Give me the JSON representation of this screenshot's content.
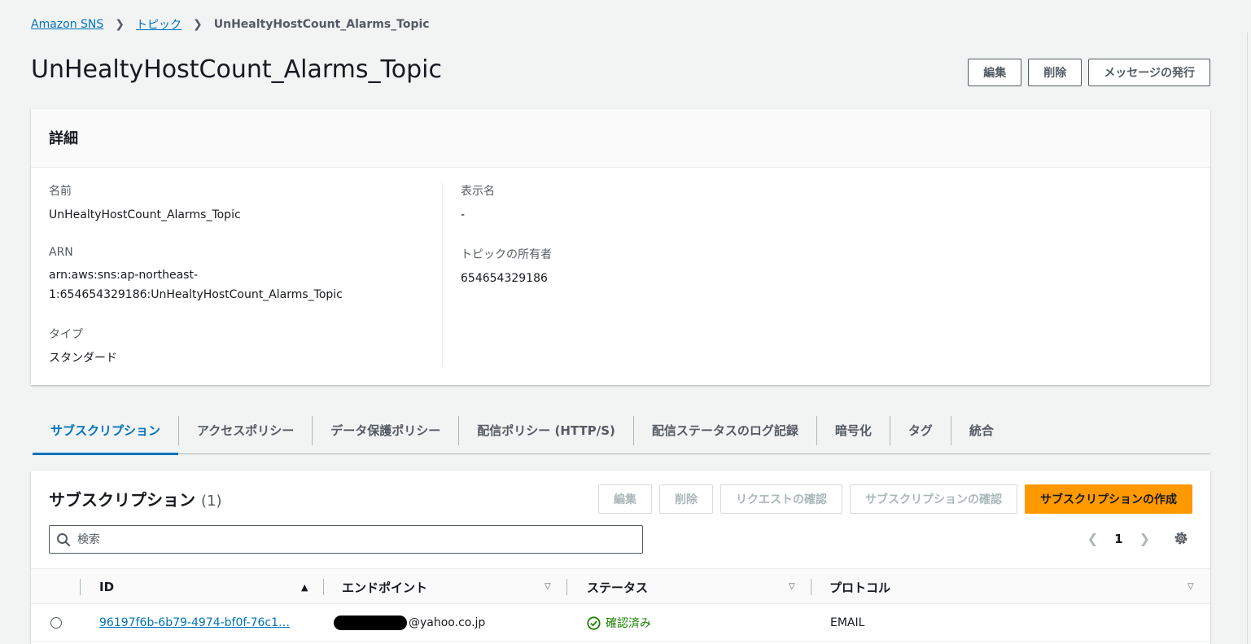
{
  "breadcrumb": {
    "root": "Amazon SNS",
    "section": "トピック",
    "current": "UnHealtyHostCount_Alarms_Topic"
  },
  "page_title": "UnHealtyHostCount_Alarms_Topic",
  "header_actions": {
    "edit": "編集",
    "delete": "削除",
    "publish": "メッセージの発行"
  },
  "details": {
    "title": "詳細",
    "name_label": "名前",
    "name_value": "UnHealtyHostCount_Alarms_Topic",
    "arn_label": "ARN",
    "arn_value_line1": "arn:aws:sns:ap-northeast-",
    "arn_value_line2": "1:654654329186:UnHealtyHostCount_Alarms_Topic",
    "type_label": "タイプ",
    "type_value": "スタンダード",
    "display_name_label": "表示名",
    "display_name_value": "-",
    "owner_label": "トピックの所有者",
    "owner_value": "654654329186"
  },
  "tabs": [
    {
      "label": "サブスクリプション"
    },
    {
      "label": "アクセスポリシー"
    },
    {
      "label": "データ保護ポリシー"
    },
    {
      "label": "配信ポリシー (HTTP/S)"
    },
    {
      "label": "配信ステータスのログ記録"
    },
    {
      "label": "暗号化"
    },
    {
      "label": "タグ"
    },
    {
      "label": "統合"
    }
  ],
  "subscriptions": {
    "title": "サブスクリプション",
    "count": "(1)",
    "edit": "編集",
    "delete": "削除",
    "request_confirm": "リクエストの確認",
    "confirm_sub": "サブスクリプションの確認",
    "create": "サブスクリプションの作成",
    "search_placeholder": "検索",
    "page": "1",
    "columns": {
      "id": "ID",
      "endpoint": "エンドポイント",
      "status": "ステータス",
      "protocol": "プロトコル"
    },
    "rows": [
      {
        "id": "96197f6b-6b79-4974-bf0f-76c1…",
        "endpoint": "@yahoo.co.jp",
        "status": "確認済み",
        "protocol": "EMAIL"
      }
    ]
  },
  "colors": {
    "link": "#0073bb",
    "primary": "#ff9900",
    "success": "#1d8102"
  }
}
